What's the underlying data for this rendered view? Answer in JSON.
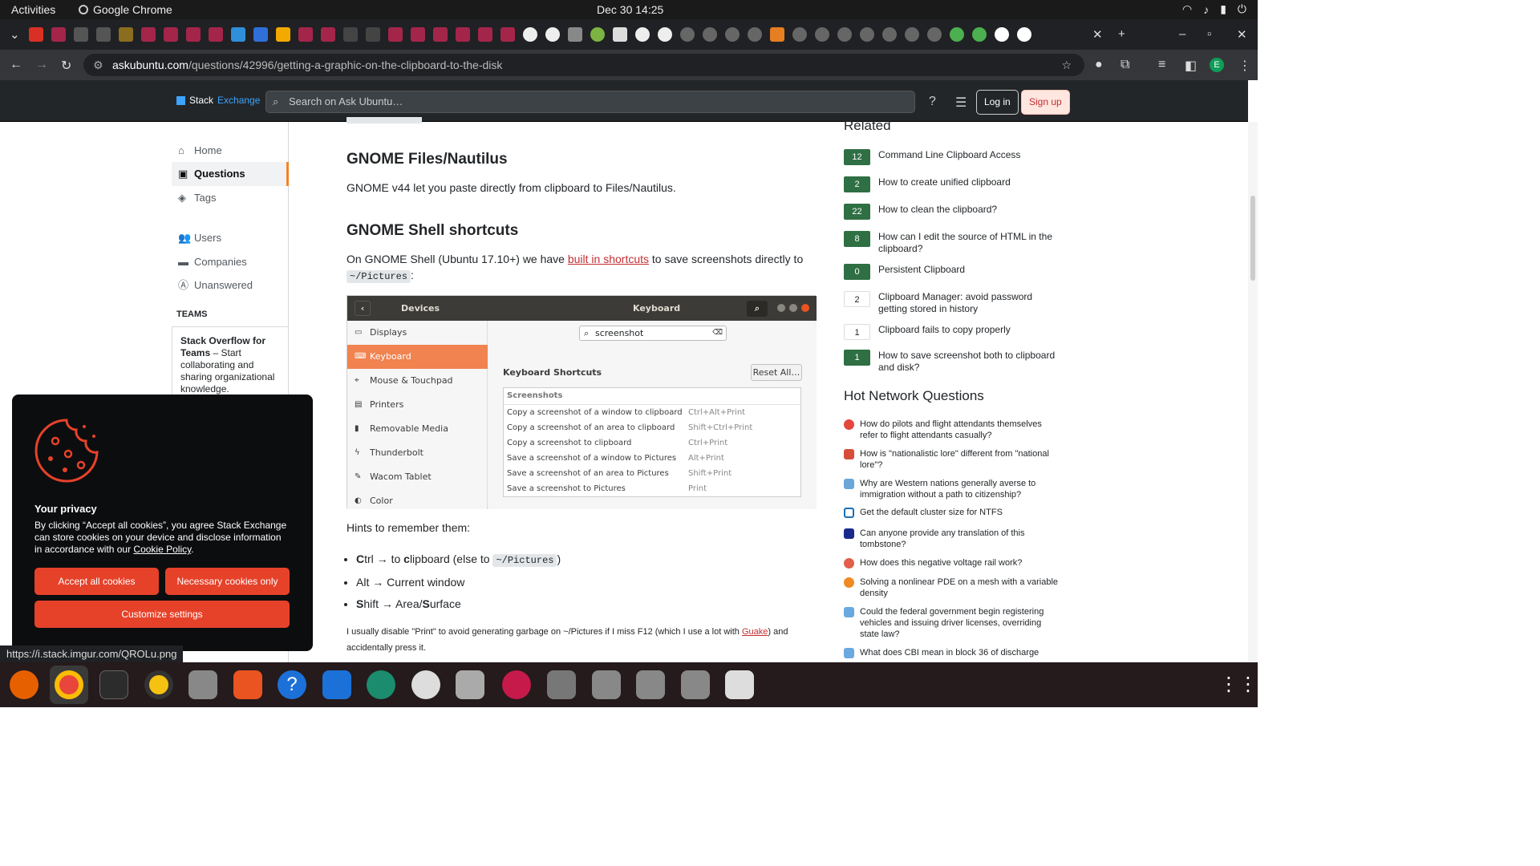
{
  "system": {
    "activities": "Activities",
    "app": "Google Chrome",
    "clock": "Dec 30  14:25"
  },
  "browser": {
    "url_host": "askubuntu.com",
    "url_path": "/questions/42996/getting-a-graphic-on-the-clipboard-to-the-disk",
    "status_url": "https://i.stack.imgur.com/QROLu.png",
    "profile_initial": "E"
  },
  "header": {
    "logo_stack": "Stack",
    "logo_exchange": "Exchange",
    "search_placeholder": "Search on Ask Ubuntu…",
    "login": "Log in",
    "signup": "Sign up"
  },
  "nav": {
    "home": "Home",
    "questions": "Questions",
    "tags": "Tags",
    "users": "Users",
    "companies": "Companies",
    "unanswered": "Unanswered",
    "teams_heading": "TEAMS",
    "teams_title": "Stack Overflow for Teams",
    "teams_text": " – Start collaborating and sharing organizational knowledge."
  },
  "answer": {
    "h_nautilus": "GNOME Files/Nautilus",
    "p_nautilus": "GNOME v44 let you paste directly from clipboard to Files/Nautilus.",
    "h_shell": "GNOME Shell shortcuts",
    "p_shell_1": "On GNOME Shell (Ubuntu 17.10+) we have ",
    "p_shell_link": "built in shortcuts",
    "p_shell_2": " to save screenshots directly to",
    "pictures_code": "~/Pictures",
    "colon": ":",
    "hints_intro": "Hints to remember them:",
    "hint1_bold": "C",
    "hint1_a": "trl → to ",
    "hint1_bold2": "c",
    "hint1_b": "lipboard (else to ",
    "hint1_code": "~/Pictures",
    "hint1_c": ")",
    "hint2": "Alt → Current window",
    "hint3_bold": "S",
    "hint3_a": "hift → Area/",
    "hint3_bold2": "S",
    "hint3_b": "urface",
    "note_1": "I usually disable \"Print\" to avoid generating garbage on ~/Pictures if I miss F12 (which I use a lot with ",
    "note_link": "Guake",
    "note_2": ") and accidentally press it."
  },
  "screenshot": {
    "devices": "Devices",
    "keyboard": "Keyboard",
    "search_value": "screenshot",
    "side": [
      "Displays",
      "Keyboard",
      "Mouse & Touchpad",
      "Printers",
      "Removable Media",
      "Thunderbolt",
      "Wacom Tablet",
      "Color"
    ],
    "kb_title": "Keyboard Shortcuts",
    "reset": "Reset All…",
    "group": "Screenshots",
    "rows": [
      {
        "action": "Copy a screenshot of a window to clipboard",
        "keys": "Ctrl+Alt+Print"
      },
      {
        "action": "Copy a screenshot of an area to clipboard",
        "keys": "Shift+Ctrl+Print"
      },
      {
        "action": "Copy a screenshot to clipboard",
        "keys": "Ctrl+Print"
      },
      {
        "action": "Save a screenshot of a window to Pictures",
        "keys": "Alt+Print"
      },
      {
        "action": "Save a screenshot of an area to Pictures",
        "keys": "Shift+Print"
      },
      {
        "action": "Save a screenshot to Pictures",
        "keys": "Print"
      }
    ]
  },
  "related": {
    "heading": "Related",
    "items": [
      {
        "votes": "12",
        "title": "Command Line Clipboard Access",
        "accepted": true
      },
      {
        "votes": "2",
        "title": "How to create unified clipboard",
        "accepted": true
      },
      {
        "votes": "22",
        "title": "How to clean the clipboard?",
        "accepted": true
      },
      {
        "votes": "8",
        "title": "How can I edit the source of HTML in the clipboard?",
        "accepted": true
      },
      {
        "votes": "0",
        "title": "Persistent Clipboard",
        "accepted": true
      },
      {
        "votes": "2",
        "title": "Clipboard Manager: avoid password getting stored in history",
        "accepted": false
      },
      {
        "votes": "1",
        "title": "Clipboard fails to copy properly",
        "accepted": false
      },
      {
        "votes": "1",
        "title": "How to save screenshot both to clipboard and disk?",
        "accepted": true
      }
    ]
  },
  "hot": {
    "heading": "Hot Network Questions",
    "items": [
      "How do pilots and flight attendants themselves refer to flight attendants casually?",
      "How is \"nationalistic lore\" different from \"national lore\"?",
      "Why are Western nations generally averse to immigration without a path to citizenship?",
      "Get the default cluster size for NTFS",
      "Can anyone provide any translation of this tombstone?",
      "How does this negative voltage rail work?",
      "Solving a nonlinear PDE on a mesh with a variable density",
      "Could the federal government begin registering vehicles and issuing driver licenses, overriding state law?",
      "What does CBI mean in block 36 of discharge"
    ]
  },
  "cookie": {
    "title": "Your privacy",
    "text_1": "By clicking “Accept all cookies”, you agree Stack Exchange can store cookies on your device and disclose information in accordance with our ",
    "policy": "Cookie Policy",
    "text_2": ".",
    "accept": "Accept all cookies",
    "necessary": "Necessary cookies only",
    "customize": "Customize settings"
  },
  "colors": {
    "accent": "#f48225",
    "accepted_green": "#2f6f44",
    "cookie_btn": "#e6422a",
    "link_red": "#c22e32"
  }
}
